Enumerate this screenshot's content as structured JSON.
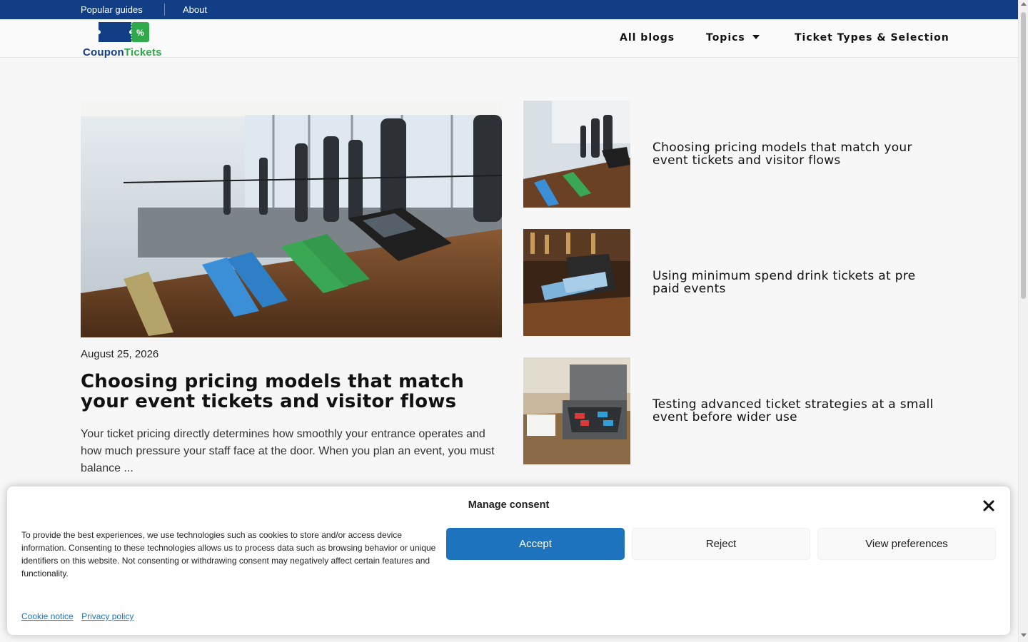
{
  "topbar": {
    "links": [
      "Popular guides",
      "About"
    ],
    "background": "#123e86"
  },
  "header": {
    "logo": {
      "part1": "Coupon",
      "part2": "Tickets",
      "badge": "%"
    },
    "nav": {
      "all_blogs": "All blogs",
      "topics": "Topics",
      "ticket_types": "Ticket Types & Selection"
    }
  },
  "featured": {
    "date": "August 25, 2026",
    "title": "Choosing pricing models that match your event tickets and visitor flows",
    "excerpt": "Your ticket pricing directly determines how smoothly your entrance operates and how much pressure your staff face at the door. When you plan an event, you must balance ..."
  },
  "side_posts": [
    {
      "title": "Choosing pricing models that match your event tickets and visitor flows"
    },
    {
      "title": "Using minimum spend drink tickets at pre paid events"
    },
    {
      "title": "Testing advanced ticket strategies at a small event before wider use"
    }
  ],
  "consent": {
    "title": "Manage consent",
    "text": "To provide the best experiences, we use technologies such as cookies to store and/or access device information. Consenting to these technologies allows us to process data such as browsing behavior or unique identifiers on this website. Not consenting or withdrawing consent may negatively affect certain features and functionality.",
    "accept": "Accept",
    "reject": "Reject",
    "preferences": "View preferences",
    "links": [
      "Cookie notice",
      "Privacy policy"
    ],
    "accent": "#1e73be"
  },
  "colors": {
    "brand_blue": "#123e86",
    "brand_green": "#2eaa4a",
    "page_bg": "#f7f7f7"
  }
}
